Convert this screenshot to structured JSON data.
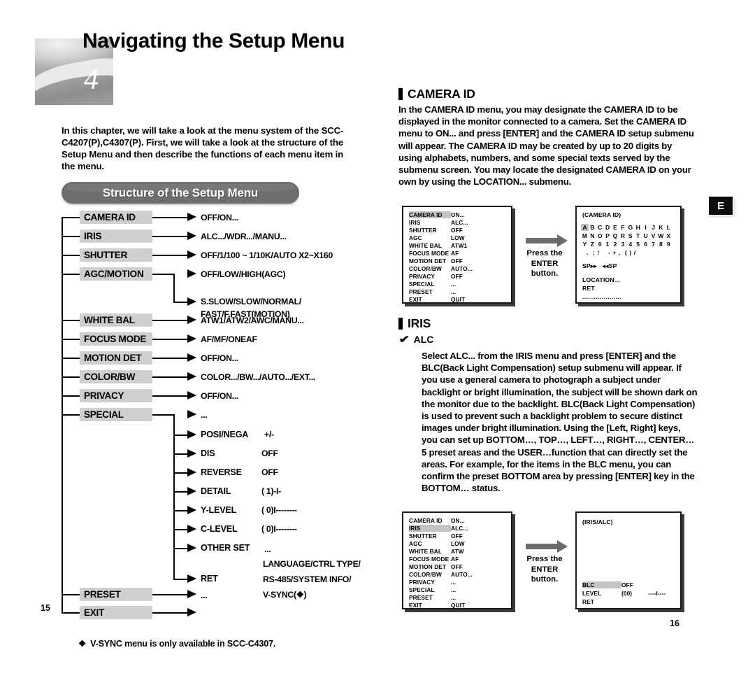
{
  "chapter": {
    "number": "4",
    "title": "Navigating the Setup Menu",
    "intro": "In this chapter, we will take a look at the menu system of the SCC-C4207(P),C4307(P). First, we will take a look at the structure of the Setup Menu and then describe the functions of each menu item in the menu."
  },
  "banner": {
    "label": "Structure of the Setup Menu"
  },
  "tree": {
    "nodes": [
      {
        "label": "CAMERA ID",
        "value": "OFF/ON..."
      },
      {
        "label": "IRIS",
        "value": "ALC.../WDR.../MANU..."
      },
      {
        "label": "SHUTTER",
        "value": "OFF/1/100 ~ 1/10K/AUTO X2~X160"
      },
      {
        "label": "AGC/MOTION",
        "value": "OFF/LOW/HIGH(AGC)",
        "value2a": "S.SLOW/SLOW/NORMAL/",
        "value2b": "FAST/F.FAST(MOTION)"
      },
      {
        "label": "WHITE BAL",
        "value": "ATW1/ATW2/AWC/MANU..."
      },
      {
        "label": "FOCUS MODE",
        "value": "AF/MF/ONEAF"
      },
      {
        "label": "MOTION DET",
        "value": "OFF/ON..."
      },
      {
        "label": "COLOR/BW",
        "value": "COLOR.../BW.../AUTO.../EXT..."
      },
      {
        "label": "PRIVACY",
        "value": "OFF/ON..."
      },
      {
        "label": "SPECIAL",
        "value": "..."
      },
      {
        "label": "PRESET",
        "value": "..."
      },
      {
        "label": "EXIT",
        "value": ""
      }
    ],
    "special_children": [
      {
        "label": "POSI/NEGA",
        "value": "+/-"
      },
      {
        "label": "DIS",
        "value": "OFF"
      },
      {
        "label": "REVERSE",
        "value": "OFF"
      },
      {
        "label": "DETAIL",
        "value": "( 1)-I-"
      },
      {
        "label": "Y-LEVEL",
        "value": "( 0)I--------"
      },
      {
        "label": "C-LEVEL",
        "value": "( 0)I--------"
      },
      {
        "label": "OTHER SET",
        "value": "..."
      }
    ],
    "other_set_detail": [
      "LANGUAGE/CTRL TYPE/",
      "RS-485/SYSTEM INFO/",
      "V-SYNC(❖)"
    ],
    "ret_label": "RET"
  },
  "footnote": {
    "marker": "❖",
    "text": "V-SYNC menu is only available in SCC-C4307."
  },
  "pages": {
    "left": "15",
    "right": "16"
  },
  "lang_badge": "E",
  "camera_id": {
    "heading": "CAMERA ID",
    "body": "In the CAMERA ID menu, you may designate the CAMERA ID to be displayed in the monitor connected to a camera. Set the CAMERA ID menu to ON... and press [ENTER] and the CAMERA ID setup submenu will appear. The CAMERA ID may be created by up to 20 digits by using alphabets, numbers, and some special texts served by the submenu screen. You may locate the designated CAMERA ID on your own by using the LOCATION... submenu."
  },
  "iris": {
    "heading": "IRIS",
    "sub_heading": "ALC",
    "checkmark": "✔",
    "body": "Select ALC... from the IRIS menu and press [ENTER] and the BLC(Back Light Compensation) setup submenu will appear. If you use a general camera to photograph a subject under backlight or bright illumination, the subject will be shown dark on the monitor due to the backlight. BLC(Back Light Compensation) is used to prevent such a backlight problem to secure distinct images under bright illumination. Using the [Left, Right] keys, you can set up BOTTOM…, TOP…, LEFT…, RIGHT…, CENTER… 5 preset areas and the USER…function that can directly set the areas. For example, for the items in the BLC menu, you can confirm the preset BOTTOM area by pressing [ENTER] key in the BOTTOM… status."
  },
  "press_enter": {
    "line1": "Press the",
    "line2": "ENTER",
    "line3": "button."
  },
  "osd_main_top": {
    "rows": [
      {
        "key": "CAMERA ID",
        "value": "ON...",
        "highlight": true
      },
      {
        "key": "IRIS",
        "value": "ALC...",
        "highlight": false
      },
      {
        "key": "SHUTTER",
        "value": "OFF",
        "highlight": false
      },
      {
        "key": "AGC",
        "value": "LOW",
        "highlight": false
      },
      {
        "key": "WHITE BAL",
        "value": "ATW1",
        "highlight": false
      },
      {
        "key": "FOCUS MODE",
        "value": "AF",
        "highlight": false
      },
      {
        "key": "MOTION DET",
        "value": "OFF",
        "highlight": false
      },
      {
        "key": "COLOR/BW",
        "value": "AUTO...",
        "highlight": false
      },
      {
        "key": "PRIVACY",
        "value": "OFF",
        "highlight": false
      },
      {
        "key": "SPECIAL",
        "value": "...",
        "highlight": false
      },
      {
        "key": "PRESET",
        "value": "...",
        "highlight": false
      },
      {
        "key": "EXIT",
        "value": "QUIT",
        "highlight": false
      }
    ]
  },
  "osd_camera_id": {
    "title": "(CAMERA ID)",
    "char_rows": [
      [
        "A",
        "B",
        "C",
        "D",
        "E",
        "F",
        "G",
        "H",
        "I",
        "J",
        "K",
        "L"
      ],
      [
        "M",
        "N",
        "O",
        "P",
        "Q",
        "R",
        "S",
        "T",
        "U",
        "V",
        "W",
        "X"
      ],
      [
        "Y",
        "Z",
        "0",
        "1",
        "2",
        "3",
        "4",
        "5",
        "6",
        "7",
        "8",
        "9"
      ]
    ],
    "selected_char": "A",
    "special_row": "  .  ; !    - + .  ( ) /",
    "space_row": "SP▸▸   ◂◂SP",
    "location": "LOCATION...",
    "ret": "RET",
    "id_field": "...................."
  },
  "osd_main_bottom": {
    "rows": [
      {
        "key": "CAMERA ID",
        "value": "ON...",
        "highlight": false
      },
      {
        "key": "IRIS",
        "value": "ALC...",
        "highlight": true
      },
      {
        "key": "SHUTTER",
        "value": "OFF",
        "highlight": false
      },
      {
        "key": "AGC",
        "value": "LOW",
        "highlight": false
      },
      {
        "key": "WHITE BAL",
        "value": "ATW",
        "highlight": false
      },
      {
        "key": "FOCUS MODE",
        "value": "AF",
        "highlight": false
      },
      {
        "key": "MOTION DET",
        "value": "OFF",
        "highlight": false
      },
      {
        "key": "COLOR/BW",
        "value": "AUTO...",
        "highlight": false
      },
      {
        "key": "PRIVACY",
        "value": "...",
        "highlight": false
      },
      {
        "key": "SPECIAL",
        "value": "...",
        "highlight": false
      },
      {
        "key": "PRESET",
        "value": "...",
        "highlight": false
      },
      {
        "key": "EXIT",
        "value": "QUIT",
        "highlight": false
      }
    ]
  },
  "osd_iris_alc": {
    "title": "(IRIS/ALC)",
    "rows": [
      {
        "key": "BLC",
        "value": "OFF",
        "extra": "",
        "highlight": true
      },
      {
        "key": "LEVEL",
        "value": "(00)",
        "extra": "----I----",
        "highlight": false
      },
      {
        "key": "RET",
        "value": "",
        "extra": "",
        "highlight": false
      }
    ]
  }
}
